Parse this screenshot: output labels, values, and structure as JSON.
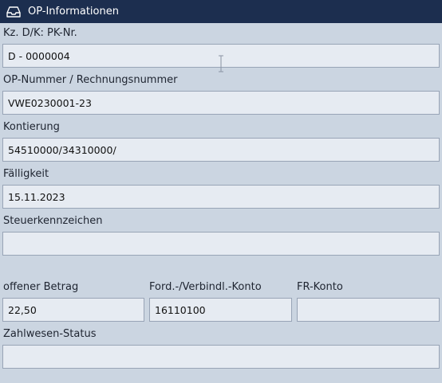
{
  "header": {
    "title": "OP-Informationen",
    "icon": "inbox-tray-icon"
  },
  "fields": {
    "kz_pk": {
      "label": "Kz. D/K: PK-Nr.",
      "value": "D - 0000004"
    },
    "op_nummer": {
      "label": "OP-Nummer / Rechnungsnummer",
      "value": "VWE0230001-23"
    },
    "kontierung": {
      "label": "Kontierung",
      "value": "54510000/34310000/"
    },
    "faelligkeit": {
      "label": "Fälligkeit",
      "value": "15.11.2023"
    },
    "steuerkennzeichen": {
      "label": "Steuerkennzeichen",
      "value": ""
    },
    "offener_betrag": {
      "label": "offener Betrag",
      "value": "22,50"
    },
    "ford_konto": {
      "label": "Ford.-/Verbindl.-Konto",
      "value": "16110100"
    },
    "fr_konto": {
      "label": "FR-Konto",
      "value": ""
    },
    "zahlwesen_status": {
      "label": "Zahlwesen-Status",
      "value": ""
    }
  },
  "colors": {
    "header_bg": "#1c2e4f",
    "panel_bg": "#cbd5e1",
    "field_bg": "#e6ebf2"
  }
}
